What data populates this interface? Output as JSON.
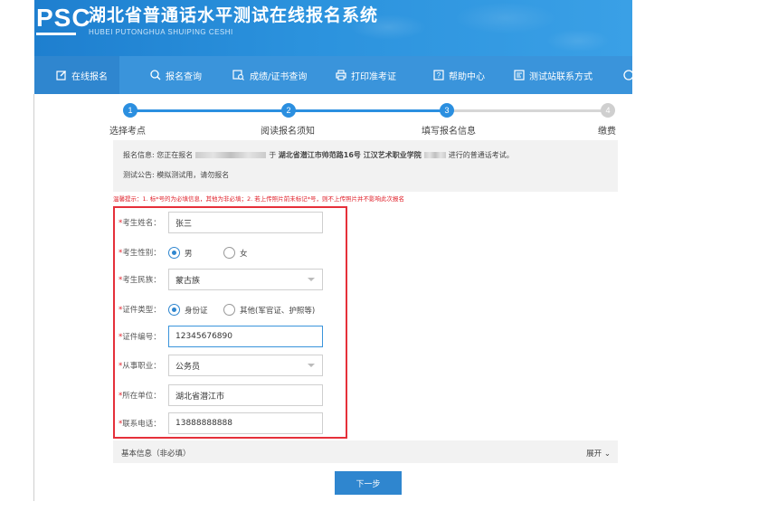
{
  "header": {
    "logo": "PSC",
    "title": "湖北省普通话水平测试在线报名系统",
    "subtitle": "HUBEI PUTONGHUA SHUIPING CESHI"
  },
  "nav": {
    "items": [
      {
        "label": "在线报名",
        "icon": "edit-icon",
        "active": true
      },
      {
        "label": "报名查询",
        "icon": "search-icon"
      },
      {
        "label": "成绩/证书查询",
        "icon": "certificate-search-icon"
      },
      {
        "label": "打印准考证",
        "icon": "printer-icon"
      },
      {
        "label": "帮助中心",
        "icon": "help-icon"
      },
      {
        "label": "测试站联系方式",
        "icon": "contact-icon"
      }
    ]
  },
  "steps": [
    {
      "num": "1",
      "label": "选择考点"
    },
    {
      "num": "2",
      "label": "阅读报名须知"
    },
    {
      "num": "3",
      "label": "填写报名信息"
    },
    {
      "num": "4",
      "label": "缴费"
    }
  ],
  "steps_current": 3,
  "info": {
    "prefix": "报名信息: 您正在报名",
    "middle": "于",
    "location": "湖北省潜江市帅范路16号 江汉艺术职业学院",
    "suffix": "进行的普通话考试。",
    "notice": "测试公告: 模拟测试用，请勿报名"
  },
  "tip": "温馨提示：1. 标*号的为必填信息，其他为非必填；2. 若上传照片前未标记*号，则不上传照片并不影响此次报名",
  "form": {
    "name_label": "考生姓名：",
    "name_value": "张三",
    "gender_label": "考生性别：",
    "gender_male": "男",
    "gender_female": "女",
    "ethnic_label": "考生民族：",
    "ethnic_value": "蒙古族",
    "idtype_label": "证件类型：",
    "idtype_id": "身份证",
    "idtype_other": "其他(军官证、护照等)",
    "idnum_label": "证件编号：",
    "idnum_value": "12345676890",
    "job_label": "从事职业：",
    "job_value": "公务员",
    "unit_label": "所在单位：",
    "unit_value": "湖北省潜江市",
    "phone_label": "联系电话：",
    "phone_value": "13888888888"
  },
  "basic": {
    "label": "基本信息（非必填）",
    "expand": "展开"
  },
  "next_button": "下一步",
  "colors": {
    "primary": "#2f86cf",
    "step_done": "#2b8fe0",
    "step_pending": "#cfcfcf",
    "required": "#e0202a",
    "highlight_box": "#e5303a"
  }
}
